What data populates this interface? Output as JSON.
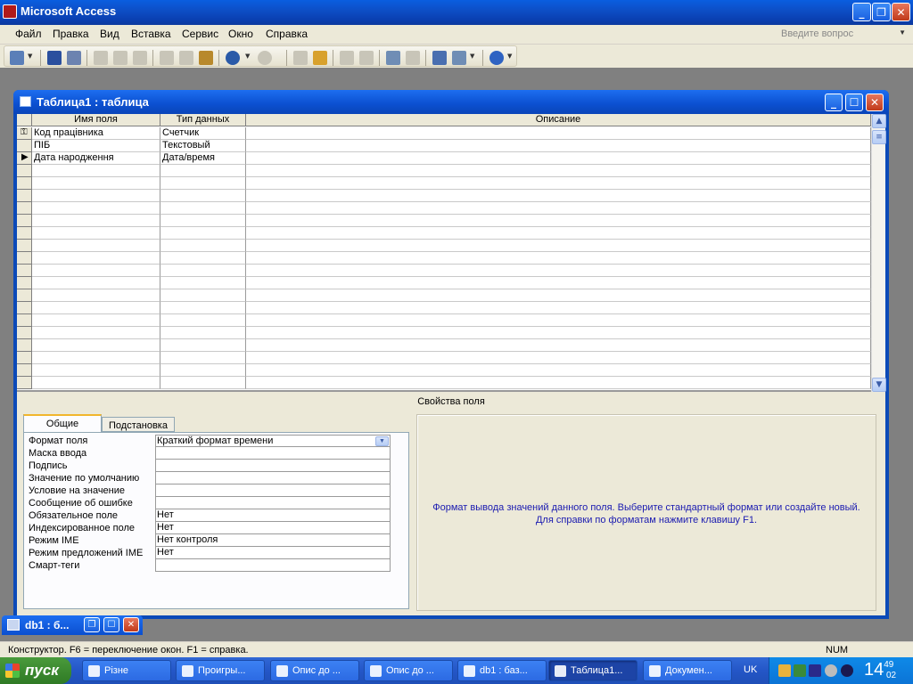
{
  "app": {
    "title": "Microsoft Access"
  },
  "menu": {
    "items": [
      "Файл",
      "Правка",
      "Вид",
      "Вставка",
      "Сервис",
      "Окно",
      "Справка"
    ],
    "ask_placeholder": "Введите вопрос"
  },
  "design_window": {
    "title": "Таблица1 : таблица",
    "columns": {
      "name": "Имя поля",
      "type": "Тип данных",
      "desc": "Описание"
    },
    "fields": [
      {
        "name": "Код працівника",
        "type": "Счетчик",
        "desc": ""
      },
      {
        "name": "ПІБ",
        "type": "Текстовый",
        "desc": ""
      },
      {
        "name": "Дата народження",
        "type": "Дата/время",
        "desc": ""
      }
    ],
    "properties_title": "Свойства поля",
    "tabs": [
      "Общие",
      "Подстановка"
    ],
    "properties": [
      {
        "label": "Формат поля",
        "value": "Краткий формат времени"
      },
      {
        "label": "Маска ввода",
        "value": ""
      },
      {
        "label": "Подпись",
        "value": ""
      },
      {
        "label": "Значение по умолчанию",
        "value": ""
      },
      {
        "label": "Условие на значение",
        "value": ""
      },
      {
        "label": "Сообщение об ошибке",
        "value": ""
      },
      {
        "label": "Обязательное поле",
        "value": "Нет"
      },
      {
        "label": "Индексированное поле",
        "value": "Нет"
      },
      {
        "label": "Режим IME",
        "value": "Нет контроля"
      },
      {
        "label": "Режим предложений IME",
        "value": "Нет"
      },
      {
        "label": "Смарт-теги",
        "value": ""
      }
    ],
    "help_line1": "Формат вывода значений данного поля.  Выберите стандартный формат или создайте новый.",
    "help_line2": "Для справки по форматам нажмите клавишу F1."
  },
  "minimized": {
    "title": "db1 : б..."
  },
  "status": {
    "text": "Конструктор.  F6 = переключение окон.  F1 = справка.",
    "num": "NUM"
  },
  "taskbar": {
    "start": "пуск",
    "tasks": [
      "Різне",
      "Проигры...",
      "Опис до ...",
      "Опис до ...",
      "db1 : баз...",
      "Таблица1...",
      "Докумен..."
    ],
    "lang": "UK",
    "clock_hm": "14",
    "clock_min": "49",
    "clock_sec": "02"
  },
  "colors": {
    "title_blue": "#0a4fd0",
    "help_text": "#1a1ab0",
    "taskbar": "#2456c7",
    "start_green": "#3c8a30"
  }
}
